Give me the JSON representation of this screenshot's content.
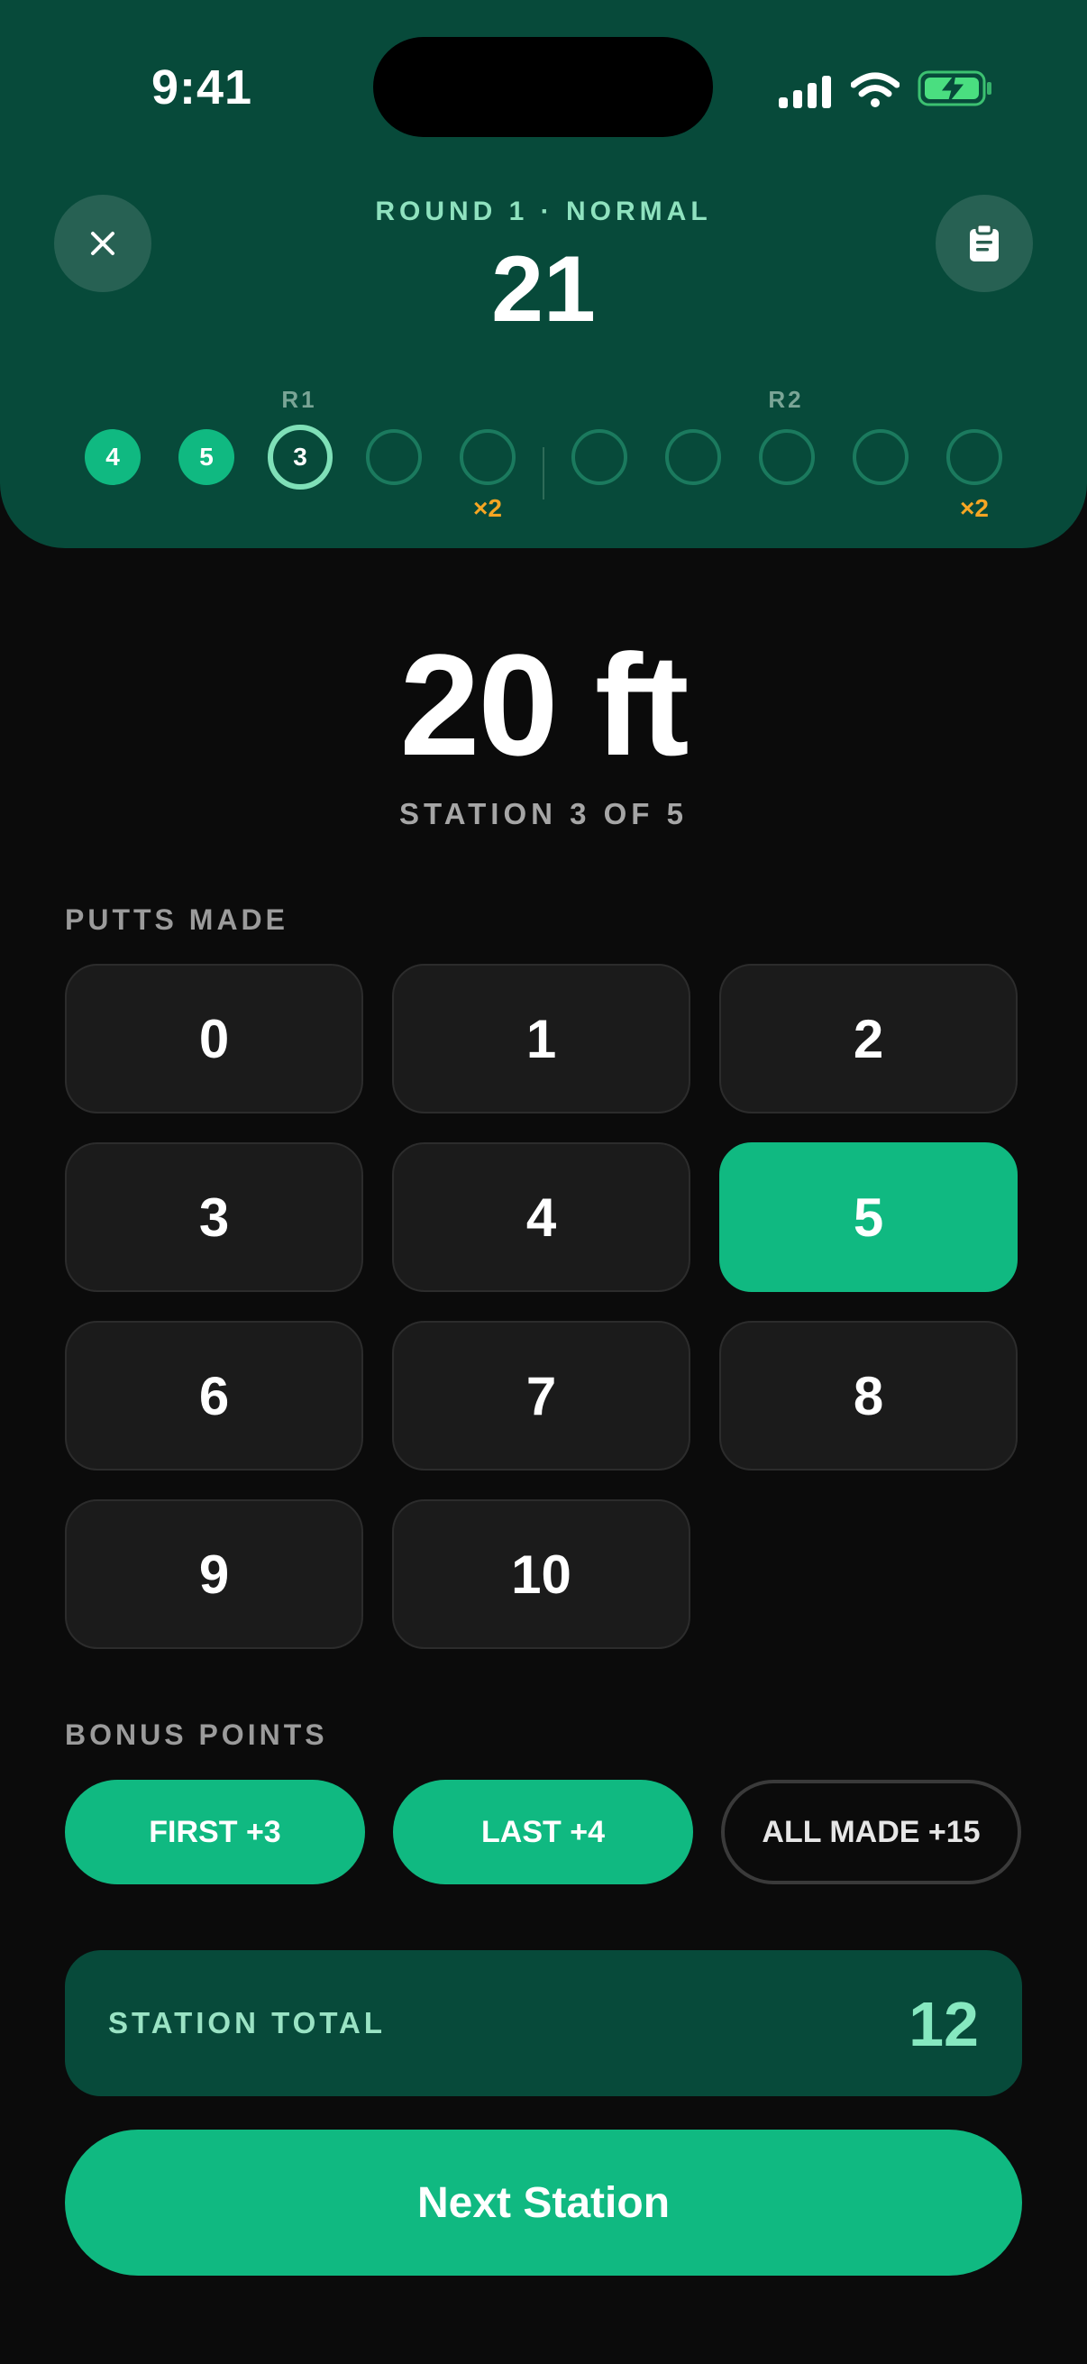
{
  "status_bar": {
    "time": "9:41",
    "icons": [
      "signal-icon",
      "wifi-icon",
      "battery-charging-icon"
    ],
    "battery_color": "#4ade80"
  },
  "header": {
    "round_label": "ROUND 1 · NORMAL",
    "round_score": "21",
    "close_icon": "close-icon",
    "scorecard_icon": "clipboard-icon",
    "tracker": {
      "groups": [
        {
          "label": "R1",
          "multiplier_label": "×2",
          "stations": [
            {
              "value": "4",
              "state": "done"
            },
            {
              "value": "5",
              "state": "done"
            },
            {
              "value": "3",
              "state": "current"
            },
            {
              "value": "",
              "state": "empty"
            },
            {
              "value": "",
              "state": "empty"
            }
          ]
        },
        {
          "label": "R2",
          "multiplier_label": "×2",
          "stations": [
            {
              "value": "",
              "state": "empty"
            },
            {
              "value": "",
              "state": "empty"
            },
            {
              "value": "",
              "state": "empty"
            },
            {
              "value": "",
              "state": "empty"
            },
            {
              "value": "",
              "state": "empty"
            }
          ]
        }
      ]
    }
  },
  "station": {
    "distance": "20 ft",
    "progress_label": "STATION 3 OF 5"
  },
  "putts": {
    "section_label": "PUTTS MADE",
    "options": [
      "0",
      "1",
      "2",
      "3",
      "4",
      "5",
      "6",
      "7",
      "8",
      "9",
      "10"
    ],
    "selected": "5"
  },
  "bonus": {
    "section_label": "BONUS POINTS",
    "options": [
      {
        "label": "FIRST +3",
        "active": true
      },
      {
        "label": "LAST +4",
        "active": true
      },
      {
        "label": "ALL MADE +15",
        "active": false
      }
    ]
  },
  "total": {
    "label": "STATION TOTAL",
    "value": "12"
  },
  "next_button": {
    "label": "Next Station"
  },
  "colors": {
    "header_bg": "#074a3a",
    "accent": "#10b981",
    "multiplier": "#f5a623",
    "background": "#0b0b0b"
  }
}
